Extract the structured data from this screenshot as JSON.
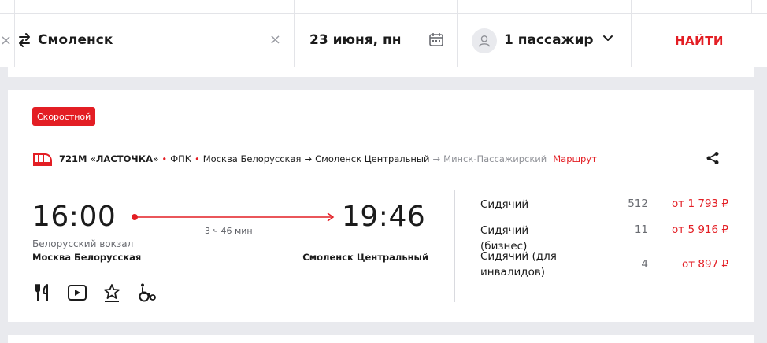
{
  "search": {
    "to_value": "Смоленск",
    "date_value": "23 июня, пн",
    "passengers_value": "1 пассажир",
    "find_label": "НАЙТИ"
  },
  "train": {
    "badge": "Скоростной",
    "name": "721М «ЛАСТОЧКА»",
    "carrier": "ФПК",
    "from_station": "Москва Белорусская",
    "to_station": "Смоленск Центральный",
    "final_station": "Минск-Пассажирский",
    "route_link": "Маршрут",
    "departure_time": "16:00",
    "arrival_time": "19:46",
    "duration": "3 ч 46 мин",
    "departure_station_label": "Белорусский вокзал",
    "departure_station": "Москва Белорусская",
    "arrival_station": "Смоленск Центральный"
  },
  "fares": [
    {
      "class": "Сидячий",
      "seats": "512",
      "price": "от 1 793 ₽"
    },
    {
      "class": "Сидячий (бизнес)",
      "seats": "11",
      "price": "от 5 916 ₽"
    },
    {
      "class": "Сидячий (для инвалидов)",
      "seats": "4",
      "price": "от 897 ₽"
    }
  ],
  "icons": {
    "swap": "swap-icon",
    "calendar": "calendar-icon",
    "avatar": "user-icon",
    "share": "share-icon",
    "train": "train-icon",
    "amenities": [
      "restaurant-icon",
      "video-icon",
      "comfort-icon",
      "wheelchair-icon"
    ]
  },
  "colors": {
    "accent": "#e31e24",
    "background": "#e9eaee",
    "card": "#ffffff"
  }
}
